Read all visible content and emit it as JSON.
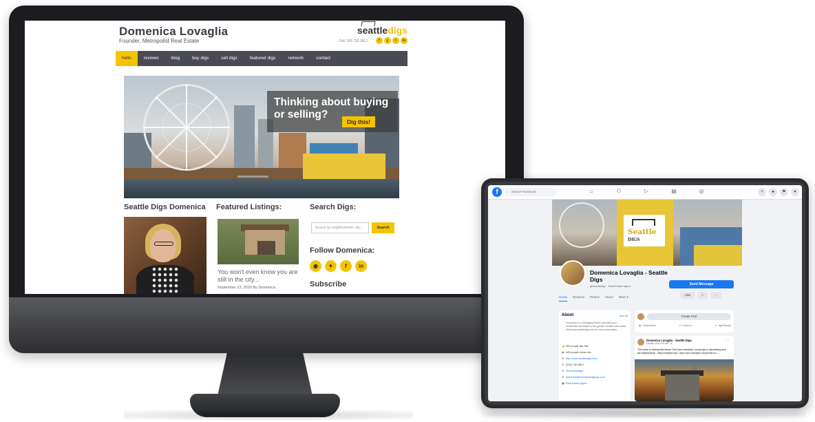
{
  "website": {
    "name": "Domenica Lovaglia",
    "tagline": "Founder, Metropolist Real Estate",
    "logo": {
      "part1": "seattle",
      "part2": "digs"
    },
    "cell": "Cell: 206.730.3812",
    "social_mini": [
      "f",
      "y",
      "t",
      "in"
    ],
    "nav": [
      "hello",
      "reviews",
      "blog",
      "buy digs",
      "sell digs",
      "featured digs",
      "network",
      "contact"
    ],
    "active_nav": "hello",
    "hero": {
      "headline": "Thinking about buying or selling?",
      "cta": "Dig this!"
    },
    "columns": {
      "about_heading": "Seattle Digs Domenica",
      "listings_heading": "Featured Listings:",
      "search_heading": "Search Digs:"
    },
    "listing": {
      "caption": "You won't even know you are still in the city...",
      "date": "September 23, 2020 By Domenica"
    },
    "search": {
      "placeholder": "Search by neighborhood, city...",
      "button": "Search"
    },
    "follow_heading": "Follow Domenica:",
    "follow_icons": [
      "rss",
      "tw",
      "f",
      "in"
    ],
    "subscribe_heading": "Subscribe"
  },
  "facebook": {
    "logo": "f",
    "search_placeholder": "Search Facebook",
    "nav_icons": [
      "⌂",
      "⚇",
      "▷",
      "▤",
      "◎"
    ],
    "right_icons": [
      "+",
      "●",
      "⚑",
      "▾"
    ],
    "cover_logo": {
      "line1": "Seattle",
      "line2": "DIGS"
    },
    "page_name": "Domenica Lovaglia - Seattle Digs",
    "handle": "@seattledigs · Real Estate Agent",
    "send_message": "Send Message",
    "tabs": [
      "Home",
      "Reviews",
      "Photos",
      "About",
      "More ▾"
    ],
    "active_tab": "Home",
    "like_button": "Like",
    "search_button": "⌕",
    "more_button": "···",
    "about": {
      "title": "About",
      "see_all": "See All",
      "description": "Domenica is a Managing Broker specializing in residential real estate in the greater Seattle metro area. Visit www.seattledigs.com for more information.",
      "items": [
        {
          "icon": "👍",
          "text": "383 people like this",
          "link": false
        },
        {
          "icon": "◉",
          "text": "425 people follow this",
          "link": false
        },
        {
          "icon": "⊕",
          "text": "http://www.seattledigs.com/",
          "link": true
        },
        {
          "icon": "✆",
          "text": "(206) 730-3812",
          "link": false
        },
        {
          "icon": "✉",
          "text": "Send Message",
          "link": true
        },
        {
          "icon": "✉",
          "text": "domenica@metropolistgroup.com",
          "link": true
        },
        {
          "icon": "▣",
          "text": "Real Estate Agent",
          "link": true
        }
      ]
    },
    "create_post": {
      "button": "Create Post",
      "actions": [
        "Photo/Video",
        "Check in",
        "Tag Friends"
      ]
    },
    "post": {
      "author": "Domenica Lovaglia - Seattle Digs",
      "time": "October 15 at 9:00 AM · ⊕",
      "text": "This week in Metropolist News: One lane extension, social tips in advertising and fall maintenance - https://mailchi.mp/...then new extension would then in..."
    }
  },
  "colors": {
    "accent": "#f5c400",
    "nav_bg": "#4a4b52",
    "fb_blue": "#1877f2",
    "device_frame": "#1c1d20"
  }
}
